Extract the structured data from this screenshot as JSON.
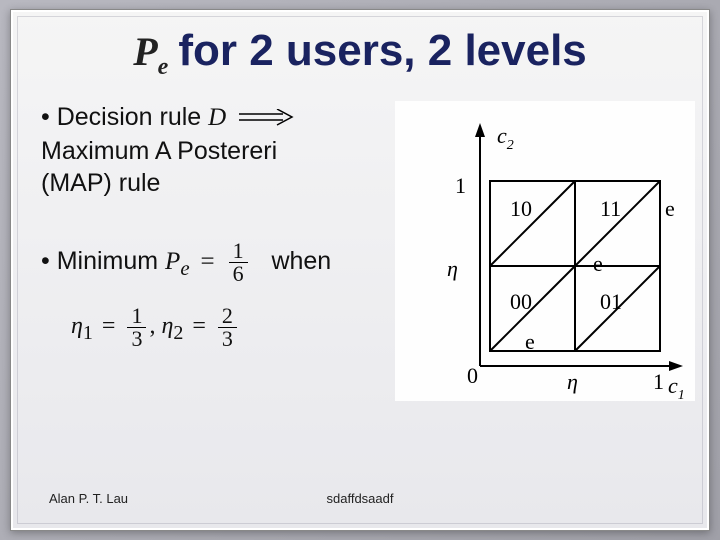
{
  "title": {
    "symbol": "P",
    "symbol_sub": "e",
    "text": "for 2 users, 2 levels"
  },
  "bullets": {
    "b1_prefix": "• Decision rule ",
    "b1_D": "D",
    "b1_rest_line1": "Maximum A Postereri",
    "b1_rest_line2": "(MAP) rule",
    "b2_prefix": "• Minimum",
    "b2_Pe_sym": "P",
    "b2_Pe_sub": "e",
    "b2_eq": "=",
    "b2_frac_num": "1",
    "b2_frac_den": "6",
    "b2_when": "when"
  },
  "eta_eq": {
    "eta": "η",
    "sub1": "1",
    "eq1": "=",
    "f1n": "1",
    "f1d": "3",
    "comma": ", ",
    "sub2": "2",
    "eq2": "=",
    "f2n": "2",
    "f2d": "3"
  },
  "figure": {
    "c2": "c",
    "c2_sub": "2",
    "c1": "c",
    "c1_sub": "1",
    "eta": "η",
    "one_y": "1",
    "one_x": "1",
    "zero_x": "0",
    "cell_10": "10",
    "cell_11": "11",
    "cell_00": "00",
    "cell_01": "01",
    "e_right": "e",
    "e_mid": "e",
    "e_bottom": "e"
  },
  "footer": {
    "author": "Alan P. T. Lau",
    "center": "sdaffdsaadf"
  }
}
